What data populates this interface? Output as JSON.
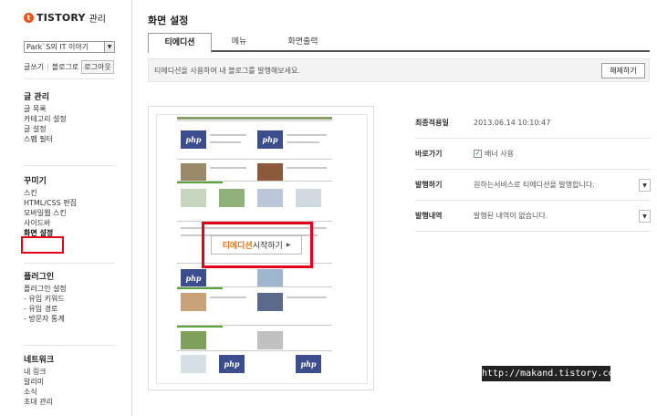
{
  "app": {
    "logo_mark": "t",
    "logo_text": "TISTORY",
    "logo_sub": "관리"
  },
  "sidebar": {
    "blog_select_value": "Park`S의 IT 이야기",
    "links": [
      "글쓰기",
      "블로그로"
    ],
    "logout_label": "로그아웃",
    "groups": [
      {
        "title": "글 관리",
        "items": [
          "글 목록",
          "카테고리 설정",
          "글 설정",
          "스팸 필터"
        ]
      },
      {
        "title": "꾸미기",
        "items": [
          "스킨",
          "HTML/CSS 편집",
          "모바일웹 스킨",
          "사이드바",
          "화면 설정"
        ]
      },
      {
        "title": "플러그인",
        "items": [
          "플러그인 설정",
          "- 유입 키워드",
          "- 유입 경로",
          "- 방문자 통계"
        ]
      },
      {
        "title": "네트워크",
        "items": [
          "내 링크",
          "알리미",
          "소식",
          "초대 관리"
        ]
      }
    ]
  },
  "main": {
    "page_title": "화면 설정",
    "tabs": [
      "티에디션",
      "메뉴",
      "화면출력"
    ],
    "info_text": "티에디션을 사용하여 내 블로그를 발행해보세요.",
    "disable_button": "해제하기",
    "start_button": {
      "highlight": "티에디션",
      "rest": " 시작하기"
    },
    "settings": [
      {
        "label": "최종적용일",
        "value": "2013.06.14 10:10:47"
      },
      {
        "label": "바로가기",
        "value": "배너 사용",
        "checked": true
      },
      {
        "label": "발행하기",
        "value": "원하는서비스로 티에디션을 발행합니다.",
        "has_dropdown": true
      },
      {
        "label": "발행내역",
        "value": "발행된 내역이 없습니다.",
        "has_dropdown": true
      }
    ]
  },
  "watermark": "http://makand.tistory.com",
  "colors": {
    "accent": "#e8531c",
    "highlight_border": "#e3001b",
    "php_blue": "#3c4d8d"
  }
}
